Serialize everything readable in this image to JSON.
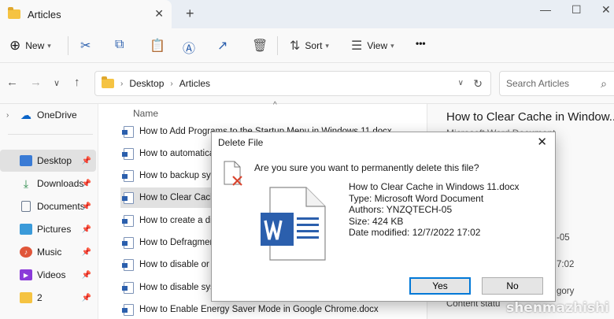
{
  "window": {
    "tab_title": "Articles",
    "tab_close": "✕",
    "tab_add": "+",
    "minimize": "—",
    "maximize": "☐",
    "close": "✕"
  },
  "toolbar": {
    "new_label": "New",
    "sort_label": "Sort",
    "view_label": "View",
    "more_label": "•••"
  },
  "address": {
    "crumbs": [
      "Desktop",
      "Articles"
    ],
    "search_placeholder": "Search Articles"
  },
  "sidebar": {
    "items": [
      {
        "label": "OneDrive",
        "icon": "cloud-icon",
        "color": "#0a64c8"
      },
      {
        "label": "Desktop",
        "icon": "desktop-icon",
        "color": "#3a7bd5",
        "selected": true
      },
      {
        "label": "Downloads",
        "icon": "download-icon",
        "color": "#2a8a4a"
      },
      {
        "label": "Documents",
        "icon": "documents-icon",
        "color": "#6b7a8f"
      },
      {
        "label": "Pictures",
        "icon": "pictures-icon",
        "color": "#3a9ad9"
      },
      {
        "label": "Music",
        "icon": "music-icon",
        "color": "#e0563a"
      },
      {
        "label": "Videos",
        "icon": "videos-icon",
        "color": "#8a3ad9"
      },
      {
        "label": "2",
        "icon": "folder-icon",
        "color": "#f5c342"
      }
    ]
  },
  "filelist": {
    "column_name": "Name",
    "rows": [
      "How to Add Programs to the Startup Menu in Windows 11.docx",
      "How to automatica",
      "How to backup sys",
      "How to Clear Cache",
      "How to create a dis",
      "How to Defragmen",
      "How to disable or r",
      "How to disable syst",
      "How to Enable Energy Saver Mode in Google Chrome.docx"
    ]
  },
  "details": {
    "title": "How to Clear Cache in Window...",
    "subtitle": "Microsoft Word Document",
    "fragments": [
      "-05",
      "7:02",
      "gory",
      "Content statu"
    ]
  },
  "dialog": {
    "title": "Delete File",
    "question": "Are you sure you want to permanently delete this file?",
    "file_name": "How to Clear Cache in Windows 11.docx",
    "file_type": "Type: Microsoft Word Document",
    "authors": "Authors: YNZQTECH-05",
    "size": "Size: 424 KB",
    "modified": "Date modified: 12/7/2022 17:02",
    "yes_label": "Yes",
    "no_label": "No"
  },
  "watermark": "shenmazhishi"
}
